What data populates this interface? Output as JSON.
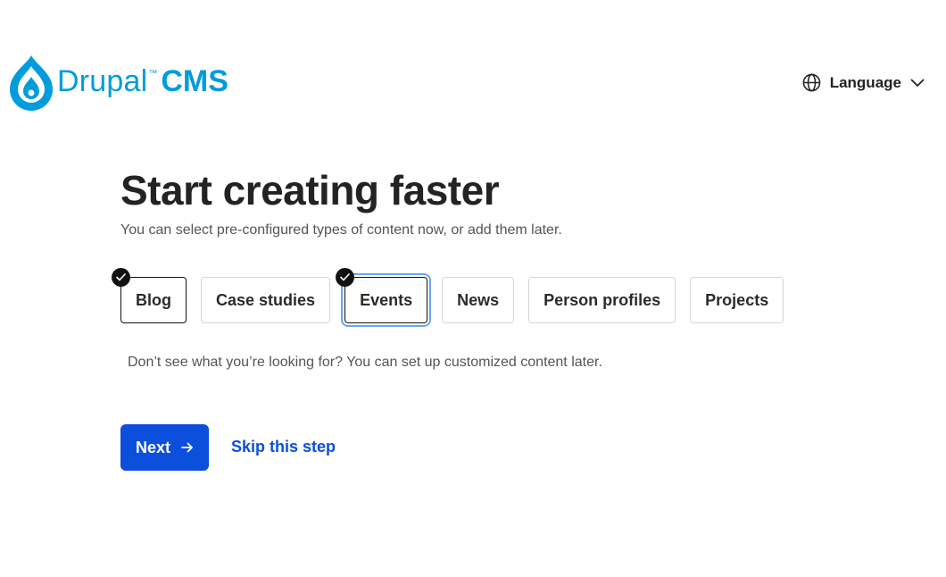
{
  "header": {
    "logo_word": "Drupal",
    "logo_tm": "™",
    "logo_cms": "CMS",
    "language_label": "Language"
  },
  "main": {
    "title": "Start creating faster",
    "subtitle": "You can select pre-configured types of content now, or add them later.",
    "options": [
      {
        "label": "Blog",
        "selected": true
      },
      {
        "label": "Case studies",
        "selected": false
      },
      {
        "label": "Events",
        "selected": true
      },
      {
        "label": "News",
        "selected": false
      },
      {
        "label": "Person profiles",
        "selected": false
      },
      {
        "label": "Projects",
        "selected": false
      }
    ],
    "hint": "Don’t see what you’re looking for? You can set up customized content later.",
    "next_label": "Next",
    "skip_label": "Skip this step"
  },
  "colors": {
    "brand": "#009cde",
    "primary_button": "#0b4fdc",
    "focus_ring": "#6aa6e8"
  }
}
